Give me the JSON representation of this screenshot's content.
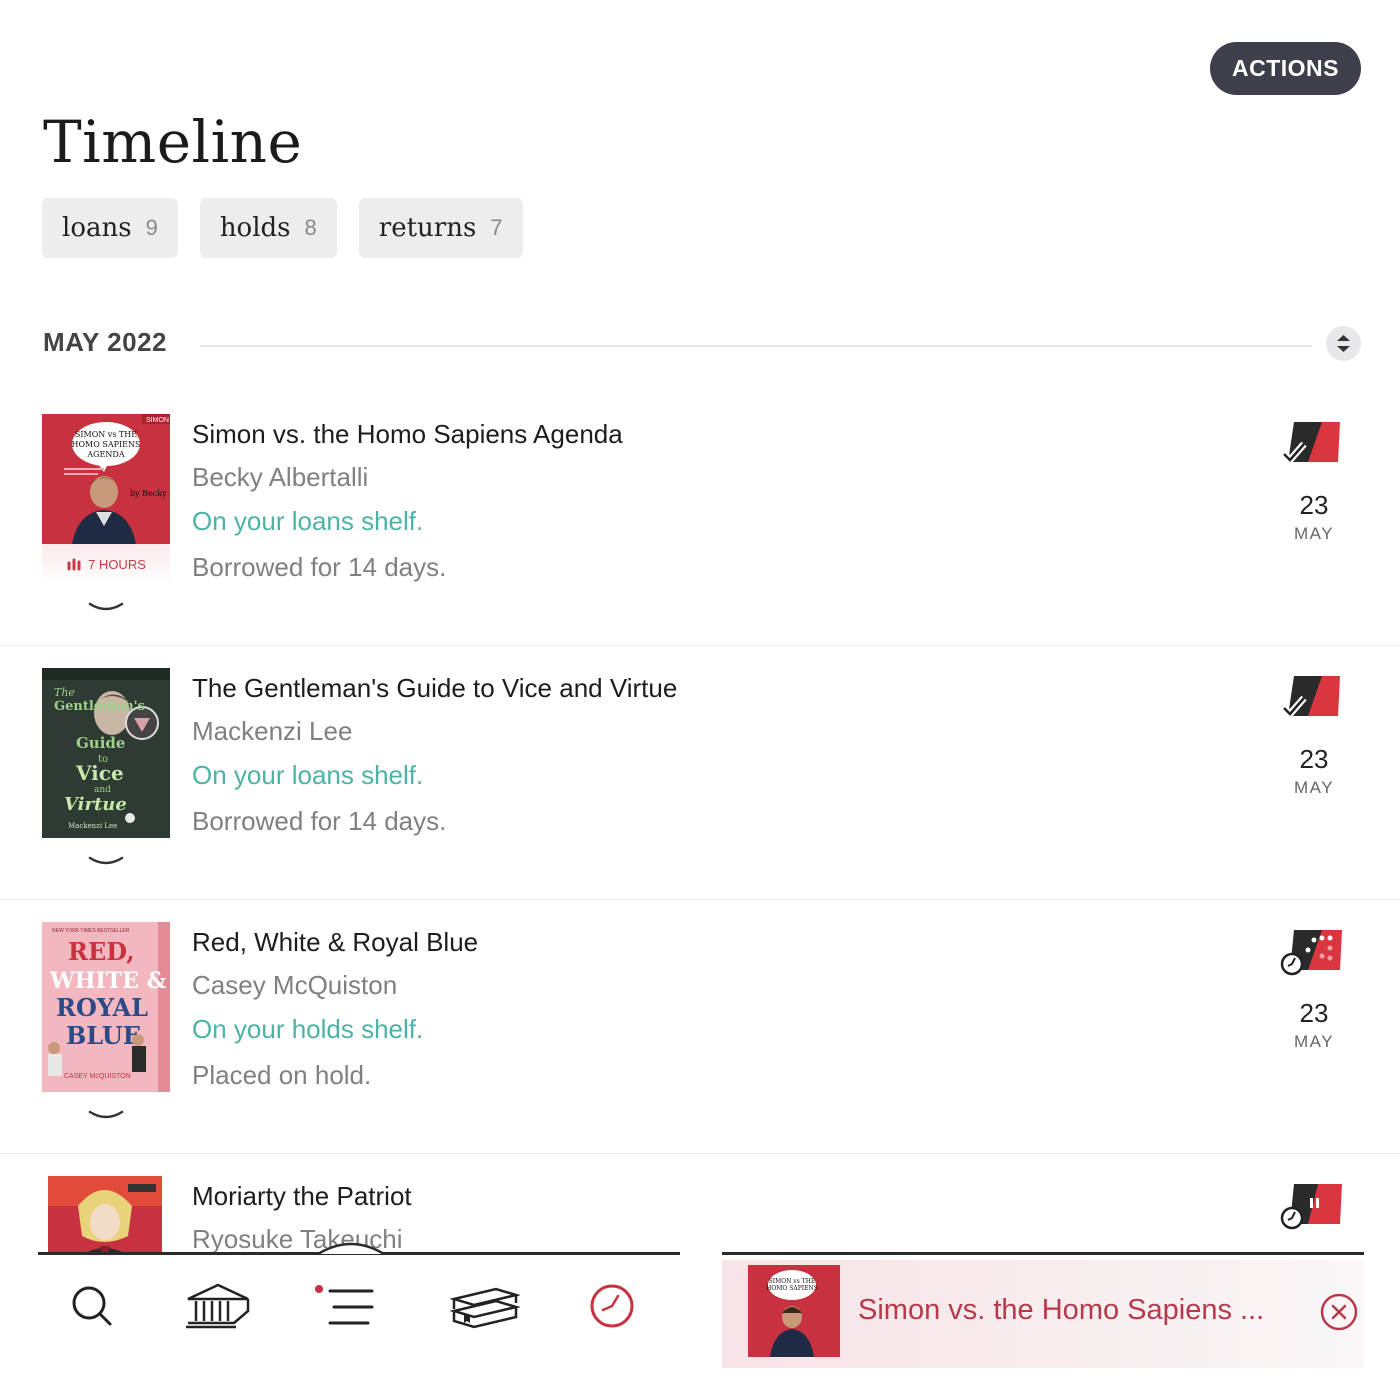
{
  "header": {
    "actions_label": "ACTIONS",
    "title": "Timeline"
  },
  "tabs": [
    {
      "label": "loans",
      "count": "9"
    },
    {
      "label": "holds",
      "count": "8"
    },
    {
      "label": "returns",
      "count": "7"
    }
  ],
  "month": {
    "label": "MAY 2022"
  },
  "items": [
    {
      "title": "Simon vs. the Homo Sapiens Agenda",
      "author": "Becky Albertalli",
      "status": "On your loans shelf.",
      "note": "Borrowed for 14 days.",
      "day": "23",
      "month": "MAY",
      "badge": "7 HOURS",
      "icon": "borrowed-icon"
    },
    {
      "title": "The Gentleman's Guide to Vice and Virtue",
      "author": "Mackenzi Lee",
      "status": "On your loans shelf.",
      "note": "Borrowed for 14 days.",
      "day": "23",
      "month": "MAY",
      "icon": "borrowed-icon"
    },
    {
      "title": "Red, White & Royal Blue",
      "author": "Casey McQuiston",
      "status": "On your holds shelf.",
      "note": "Placed on hold.",
      "day": "23",
      "month": "MAY",
      "icon": "hold-placed-icon"
    },
    {
      "title": "Moriarty the Patriot",
      "author": "Ryosuke Takeuchi",
      "icon": "hold-paused-icon"
    }
  ],
  "covers": {
    "simon": {
      "top_mark": "SIMON",
      "line1": "SIMON vs THE",
      "line2": "HOMO SAPIENS",
      "line3": "AGENDA",
      "byline": "by Becky Albertalli"
    },
    "gentleman": {
      "line1": "The",
      "line2": "Gentleman's",
      "line3": "Guide",
      "line4": "to",
      "line5": "Vice",
      "line6": "and",
      "line7": "Virtue",
      "author": "Mackenzi Lee"
    },
    "redwhite": {
      "top": "NEW YORK TIMES BESTSELLER",
      "line1": "RED,",
      "line2": "WHITE &",
      "line3": "ROYAL",
      "line4": "BLUE",
      "author": "CASEY McQUISTON"
    }
  },
  "nav": {
    "items": [
      "search-icon",
      "libraries-icon",
      "menu-icon",
      "shelf-icon",
      "timeline-icon"
    ],
    "active": "timeline-icon"
  },
  "mini_player": {
    "title": "Simon vs. the Homo Sapiens ..."
  },
  "colors": {
    "accent": "#c73a48",
    "teal": "#4db3a4",
    "dark_button": "#3e3f4a"
  }
}
